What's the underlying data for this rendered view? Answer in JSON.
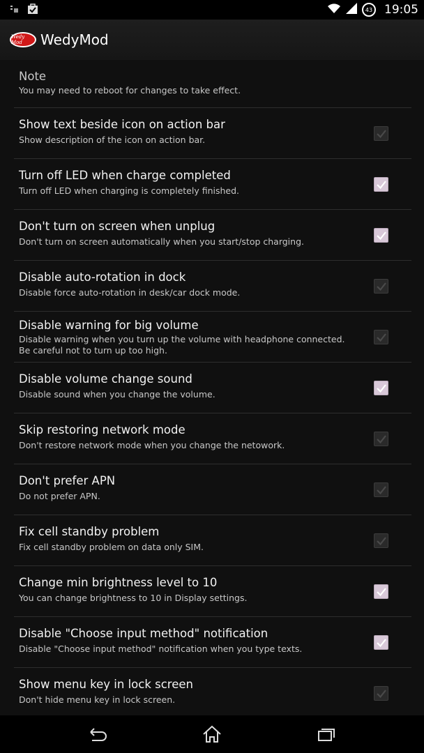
{
  "status_bar": {
    "time": "19:05",
    "battery_level": "43",
    "icons": [
      "notification-icon",
      "shopping-bag-icon",
      "wifi-icon",
      "signal-icon",
      "battery-icon"
    ]
  },
  "action_bar": {
    "app_name": "WedyMod",
    "logo_text": "Wedy Mod"
  },
  "note": {
    "title": "Note",
    "summary": "You may need to reboot for changes to take effect."
  },
  "preferences": [
    {
      "title": "Show text beside icon on action bar",
      "summary": "Show description of the icon on action bar.",
      "checked": false,
      "enabled": false
    },
    {
      "title": "Turn off LED when charge completed",
      "summary": "Turn off LED when charging is completely finished.",
      "checked": true,
      "enabled": true
    },
    {
      "title": "Don't turn on screen when unplug",
      "summary": "Don't turn on screen automatically when you start/stop charging.",
      "checked": true,
      "enabled": true
    },
    {
      "title": "Disable auto-rotation in dock",
      "summary": "Disable force auto-rotation in desk/car dock mode.",
      "checked": false,
      "enabled": false
    },
    {
      "title": "Disable warning for big volume",
      "summary": "Disable warning when you turn up the volume with headphone connected.\nBe careful not to turn up too high.",
      "checked": false,
      "enabled": false
    },
    {
      "title": "Disable volume change sound",
      "summary": "Disable sound when you change the volume.",
      "checked": true,
      "enabled": true
    },
    {
      "title": "Skip restoring network mode",
      "summary": "Don't restore network mode when you change the netowork.",
      "checked": false,
      "enabled": false
    },
    {
      "title": "Don't prefer APN",
      "summary": "Do not prefer APN.",
      "checked": false,
      "enabled": false
    },
    {
      "title": "Fix cell standby problem",
      "summary": "Fix cell standby problem on data only SIM.",
      "checked": false,
      "enabled": false
    },
    {
      "title": "Change min brightness level to 10",
      "summary": "You can change brightness to 10 in Display settings.",
      "checked": true,
      "enabled": true
    },
    {
      "title": "Disable \"Choose input method\" notification",
      "summary": "Disable \"Choose input method\" notification when you type texts.",
      "checked": true,
      "enabled": true
    },
    {
      "title": "Show menu key in lock screen",
      "summary": "Don't hide menu key in lock screen.",
      "checked": false,
      "enabled": false
    }
  ],
  "nav_bar": {
    "buttons": [
      "back-icon",
      "home-icon",
      "recent-apps-icon"
    ]
  }
}
